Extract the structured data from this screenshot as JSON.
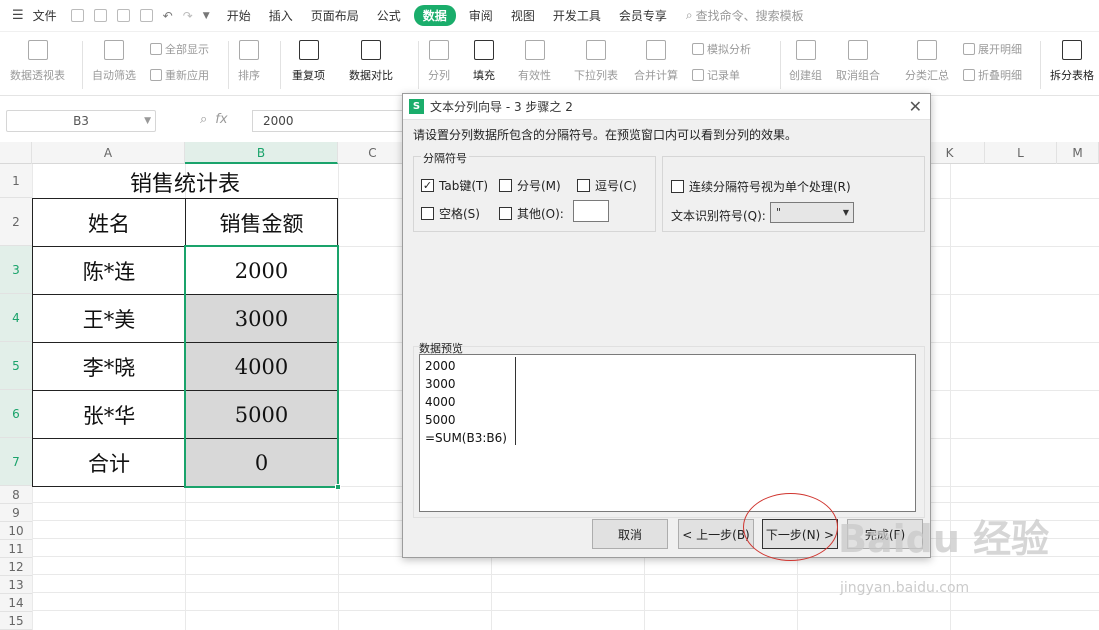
{
  "menubar": {
    "file_label": "文件",
    "tabs": [
      "开始",
      "插入",
      "页面布局",
      "公式",
      "数据",
      "审阅",
      "视图",
      "开发工具",
      "会员专享"
    ],
    "active_tab": "数据",
    "search_label": "查找命令、搜索模板"
  },
  "ribbon": {
    "pivot": "数据透视表",
    "autofilter": "自动筛选",
    "show_all": "全部显示",
    "reapply": "重新应用",
    "sort": "排序",
    "duplicates": "重复项",
    "compare": "数据对比",
    "split": "分列",
    "fill": "填充",
    "validity": "有效性",
    "dropdown": "下拉列表",
    "consolidate": "合并计算",
    "whatif": "模拟分析",
    "record": "记录单",
    "group": "创建组",
    "ungroup": "取消组合",
    "subtotal": "分类汇总",
    "expand": "展开明细",
    "collapse": "折叠明细",
    "splittable": "拆分表格"
  },
  "formula_bar": {
    "name_box": "B3",
    "fx": "fx",
    "value": "2000"
  },
  "columns": [
    "A",
    "B",
    "C",
    "K",
    "L",
    "M"
  ],
  "rows": [
    "1",
    "2",
    "3",
    "4",
    "5",
    "6",
    "7",
    "8",
    "9",
    "10",
    "11",
    "12",
    "13",
    "14",
    "15"
  ],
  "sheet": {
    "title": "销售统计表",
    "header_name": "姓名",
    "header_amount": "销售金额",
    "records": [
      {
        "name": "陈*连",
        "amount": "2000"
      },
      {
        "name": "王*美",
        "amount": "3000"
      },
      {
        "name": "李*晓",
        "amount": "4000"
      },
      {
        "name": "张*华",
        "amount": "5000"
      },
      {
        "name": "合计",
        "amount": "0"
      }
    ]
  },
  "dialog": {
    "title": "文本分列向导 - 3 步骤之 2",
    "instruction": "请设置分列数据所包含的分隔符号。在预览窗口内可以看到分列的效果。",
    "delimiter_group": "分隔符号",
    "tab": "Tab键(T)",
    "semicolon": "分号(M)",
    "comma": "逗号(C)",
    "space": "空格(S)",
    "other": "其他(O):",
    "consecutive": "连续分隔符号视为单个处理(R)",
    "qualifier_label": "文本识别符号(Q):",
    "qualifier_value": "\"",
    "preview_label": "数据预览",
    "preview_lines": [
      "2000",
      "3000",
      "4000",
      "5000",
      "=SUM(B3:B6)"
    ],
    "buttons": {
      "cancel": "取消",
      "back": "< 上一步(B)",
      "next": "下一步(N) >",
      "finish": "完成(F)"
    },
    "tab_checked": "✓"
  },
  "watermark": {
    "brand": "Baidu 经验",
    "url": "jingyan.baidu.com"
  }
}
